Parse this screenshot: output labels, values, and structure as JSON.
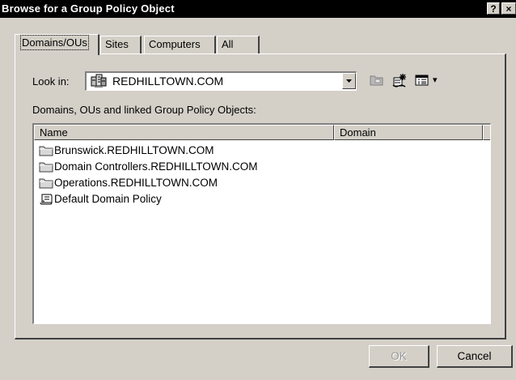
{
  "window": {
    "title": "Browse for a Group Policy Object",
    "help_label": "?",
    "close_label": "×"
  },
  "tabs": [
    {
      "label": "Domains/OUs",
      "active": true
    },
    {
      "label": "Sites",
      "active": false
    },
    {
      "label": "Computers",
      "active": false
    },
    {
      "label": "All",
      "active": false
    }
  ],
  "look_in": {
    "label": "Look in:",
    "value": "REDHILLTOWN.COM"
  },
  "toolbar": {
    "new_folder_icon": "folder-up-icon",
    "new_gpo_icon": "new-gpo-icon",
    "view_icon": "view-menu-icon",
    "view_dropdown_glyph": "▾"
  },
  "list": {
    "caption": "Domains, OUs and linked Group Policy Objects:",
    "columns": [
      "Name",
      "Domain"
    ],
    "rows": [
      {
        "name": "Brunswick.REDHILLTOWN.COM",
        "icon": "folder-icon",
        "domain": ""
      },
      {
        "name": "Domain Controllers.REDHILLTOWN.COM",
        "icon": "folder-icon",
        "domain": ""
      },
      {
        "name": "Operations.REDHILLTOWN.COM",
        "icon": "folder-icon",
        "domain": ""
      },
      {
        "name": "Default Domain Policy",
        "icon": "gpo-scroll-icon",
        "domain": ""
      }
    ]
  },
  "buttons": {
    "ok_label": "OK",
    "ok_enabled": false,
    "cancel_label": "Cancel"
  },
  "colors": {
    "face": "#d4d0c8",
    "title_bar": "#000000",
    "folder": "#d8d8d8"
  }
}
